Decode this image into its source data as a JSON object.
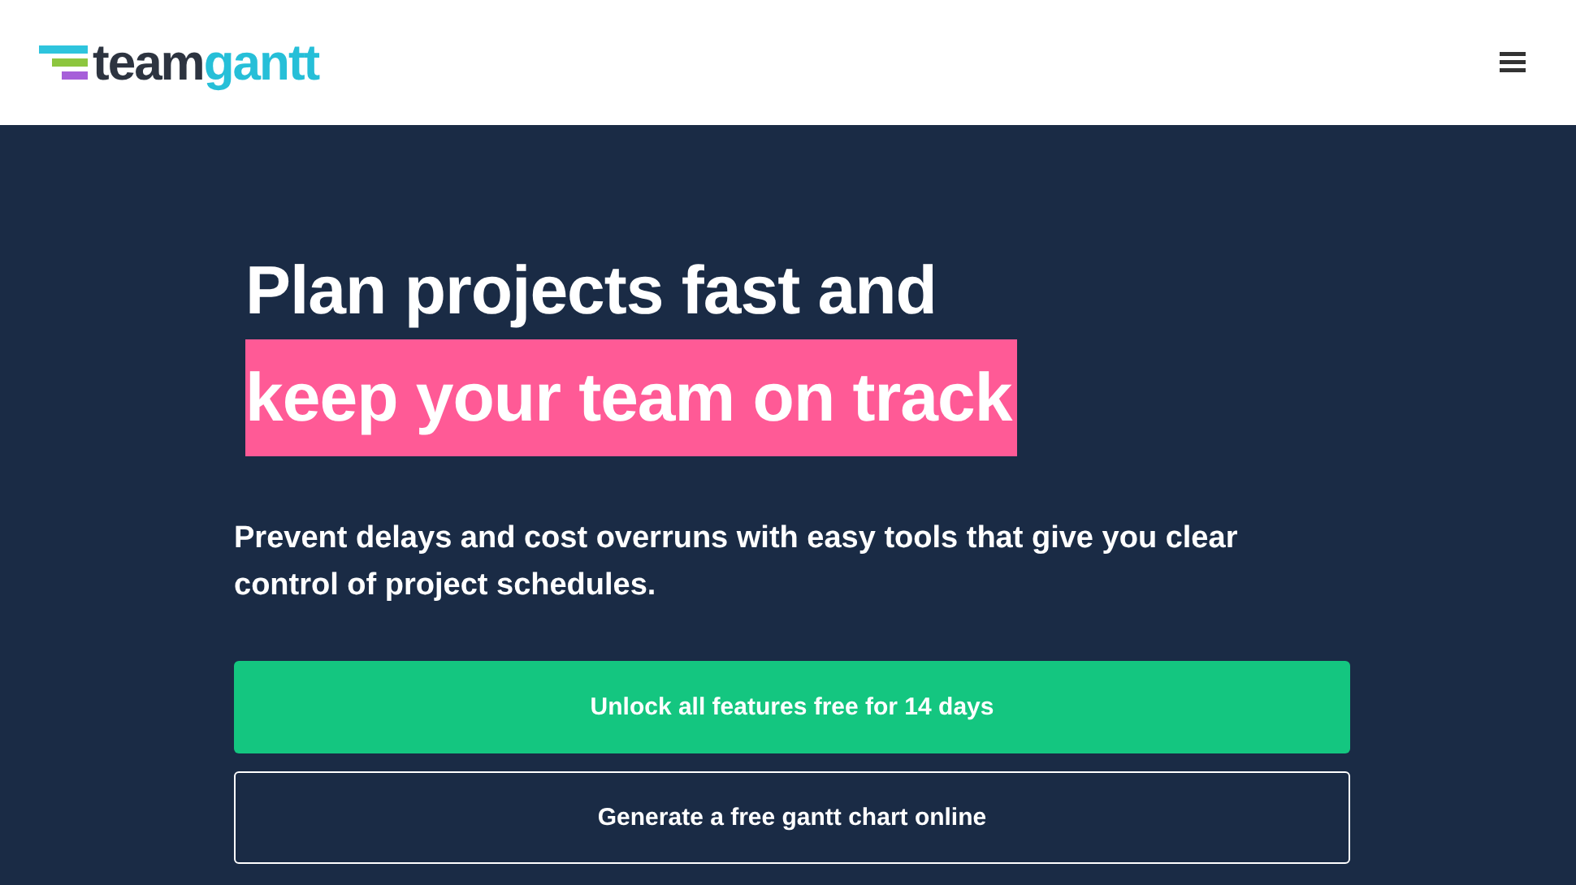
{
  "header": {
    "logo": {
      "part_1": "team",
      "part_2": "gantt"
    }
  },
  "hero": {
    "headline_line_1": "Plan projects fast and",
    "headline_line_2": "keep your team on track",
    "subtitle": "Prevent delays and cost overruns with easy tools that give you clear control of project schedules.",
    "buttons": [
      {
        "label": "Unlock all features free for 14 days",
        "kind": "primary"
      },
      {
        "label": "Generate a free gantt chart online",
        "kind": "outline"
      }
    ]
  }
}
